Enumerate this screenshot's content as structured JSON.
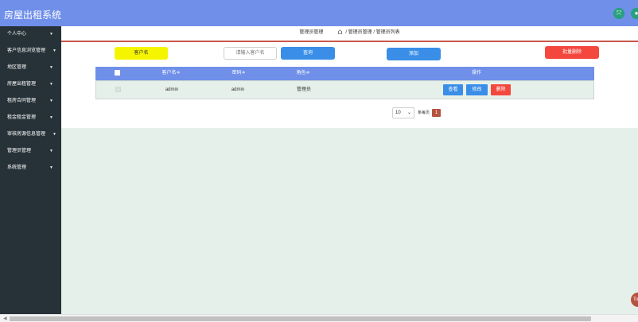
{
  "app": {
    "title": "房屋出租系统"
  },
  "header": {
    "expand_icon": "expand-arrows-icon",
    "user_icon": "user-icon",
    "accent": "#28a07e",
    "bar_color": "#6f8fe9"
  },
  "sidebar": {
    "items": [
      {
        "label": "个人中心"
      },
      {
        "label": "客户信息浏览管理"
      },
      {
        "label": "地区管理"
      },
      {
        "label": "房屋出租管理"
      },
      {
        "label": "租房合同管理"
      },
      {
        "label": "租金租金管理"
      },
      {
        "label": "审核房源信息管理"
      },
      {
        "label": "管理员管理"
      },
      {
        "label": "系统管理"
      }
    ]
  },
  "breadcrumb": {
    "current": "管理员管理",
    "path": "/ 管理员管理 / 管理员列表"
  },
  "toolbar": {
    "customer_label": "客户名",
    "search_placeholder": "请输入客户名",
    "query_label": "查询",
    "add_label": "添加",
    "batch_delete_label": "批量删除"
  },
  "table": {
    "columns": [
      "客户名≑",
      "密码≑",
      "角色≑",
      "操作"
    ],
    "rows": [
      {
        "username": "admin",
        "password": "admin",
        "role": "管理员"
      }
    ],
    "actions": {
      "view": "查看",
      "edit": "修改",
      "delete": "删除"
    }
  },
  "pager": {
    "page_size": "10",
    "per_page_label": "条每页",
    "current_page": "1"
  },
  "colors": {
    "primary": "#3a8ee8",
    "danger": "#f4473e",
    "warning": "#f5f500",
    "header": "#6f8fe9",
    "sidebar": "#263238",
    "page_num": "#b5533f"
  },
  "float_button": {
    "label": "To"
  }
}
